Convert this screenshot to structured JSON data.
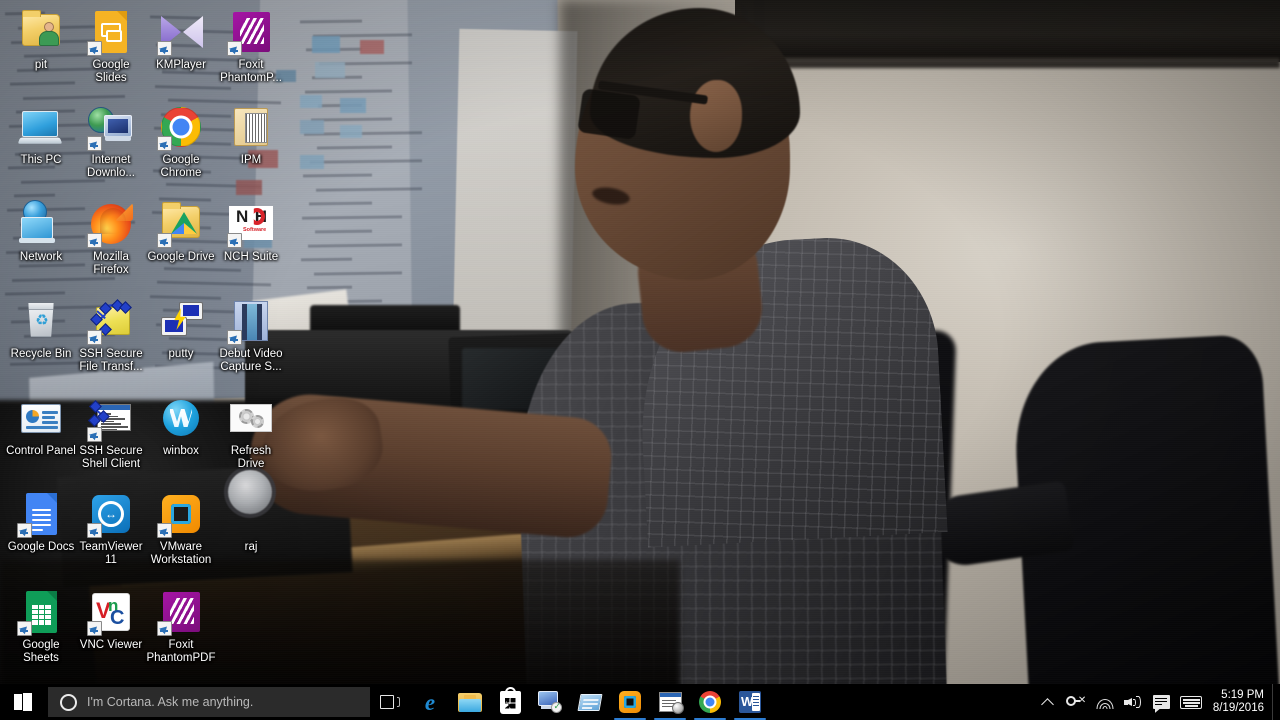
{
  "desktop": {
    "wallpaper_description": "Photo of a man in a checkered shirt wearing glasses, seated at a wooden desk using a keyboard next to a black printer, with an office chair at right",
    "icons": [
      {
        "label": "pit",
        "icon": "user-folder-icon",
        "shortcut": false,
        "col": 0,
        "row": 0
      },
      {
        "label": "Google Slides",
        "icon": "google-slides-icon",
        "shortcut": true,
        "col": 1,
        "row": 0
      },
      {
        "label": "KMPlayer",
        "icon": "kmplayer-icon",
        "shortcut": true,
        "col": 2,
        "row": 0
      },
      {
        "label": "Foxit PhantomP...",
        "icon": "foxit-phantompdf-icon",
        "shortcut": true,
        "col": 3,
        "row": 0
      },
      {
        "label": "This PC",
        "icon": "this-pc-icon",
        "shortcut": false,
        "col": 0,
        "row": 1
      },
      {
        "label": "Internet Downlo...",
        "icon": "internet-download-manager-icon",
        "shortcut": true,
        "col": 1,
        "row": 1
      },
      {
        "label": "Google Chrome",
        "icon": "google-chrome-icon",
        "shortcut": true,
        "col": 2,
        "row": 1
      },
      {
        "label": "IPM",
        "icon": "ipm-folder-icon",
        "shortcut": false,
        "col": 3,
        "row": 1
      },
      {
        "label": "Network",
        "icon": "network-icon",
        "shortcut": false,
        "col": 0,
        "row": 2
      },
      {
        "label": "Mozilla Firefox",
        "icon": "mozilla-firefox-icon",
        "shortcut": true,
        "col": 1,
        "row": 2
      },
      {
        "label": "Google Drive",
        "icon": "google-drive-icon",
        "shortcut": true,
        "col": 2,
        "row": 2
      },
      {
        "label": "NCH Suite",
        "icon": "nch-software-icon",
        "shortcut": true,
        "col": 3,
        "row": 2
      },
      {
        "label": "Recycle Bin",
        "icon": "recycle-bin-icon",
        "shortcut": false,
        "col": 0,
        "row": 3
      },
      {
        "label": "SSH Secure File Transf...",
        "icon": "ssh-secure-file-transfer-icon",
        "shortcut": true,
        "col": 1,
        "row": 3
      },
      {
        "label": "putty",
        "icon": "putty-icon",
        "shortcut": false,
        "col": 2,
        "row": 3
      },
      {
        "label": "Debut Video Capture S...",
        "icon": "debut-video-capture-icon",
        "shortcut": true,
        "col": 3,
        "row": 3
      },
      {
        "label": "Control Panel",
        "icon": "control-panel-icon",
        "shortcut": false,
        "col": 0,
        "row": 4
      },
      {
        "label": "SSH Secure Shell Client",
        "icon": "ssh-secure-shell-client-icon",
        "shortcut": true,
        "col": 1,
        "row": 4
      },
      {
        "label": "winbox",
        "icon": "winbox-icon",
        "shortcut": false,
        "col": 2,
        "row": 4
      },
      {
        "label": "Refresh Drive",
        "icon": "refresh-drive-icon",
        "shortcut": false,
        "col": 3,
        "row": 4
      },
      {
        "label": "Google Docs",
        "icon": "google-docs-icon",
        "shortcut": true,
        "col": 0,
        "row": 5
      },
      {
        "label": "TeamViewer 11",
        "icon": "teamviewer-icon",
        "shortcut": true,
        "col": 1,
        "row": 5
      },
      {
        "label": "VMware Workstation",
        "icon": "vmware-workstation-icon",
        "shortcut": true,
        "col": 2,
        "row": 5
      },
      {
        "label": "raj",
        "icon": "raj-file-icon",
        "shortcut": false,
        "col": 3,
        "row": 5
      },
      {
        "label": "Google Sheets",
        "icon": "google-sheets-icon",
        "shortcut": true,
        "col": 0,
        "row": 6
      },
      {
        "label": "VNC Viewer",
        "icon": "vnc-viewer-icon",
        "shortcut": true,
        "col": 1,
        "row": 6
      },
      {
        "label": "Foxit PhantomPDF",
        "icon": "foxit-phantompdf-icon",
        "shortcut": true,
        "col": 2,
        "row": 6
      }
    ]
  },
  "taskbar": {
    "start": {
      "label": "Start",
      "icon": "windows-logo-icon"
    },
    "search": {
      "placeholder": "I'm Cortana. Ask me anything.",
      "value": "",
      "icon": "cortana-circle-icon"
    },
    "task_view": {
      "label": "Task View",
      "icon": "task-view-icon"
    },
    "pinned": [
      {
        "label": "Microsoft Edge",
        "icon": "microsoft-edge-icon",
        "running": false
      },
      {
        "label": "File Explorer",
        "icon": "file-explorer-icon",
        "running": false
      },
      {
        "label": "Microsoft Store",
        "icon": "microsoft-store-icon",
        "running": false
      },
      {
        "label": "Remote Desktop",
        "icon": "remote-desktop-icon",
        "running": false
      },
      {
        "label": "Notepad",
        "icon": "notepad-icon",
        "running": false
      },
      {
        "label": "VMware Workstation",
        "icon": "vmware-icon",
        "running": true
      },
      {
        "label": "SSH Secure Shell Client",
        "icon": "ssh-shell-client-icon",
        "running": true
      },
      {
        "label": "Google Chrome",
        "icon": "chrome-icon",
        "running": true
      },
      {
        "label": "Microsoft Word",
        "icon": "microsoft-word-icon",
        "running": true
      }
    ],
    "tray": [
      {
        "label": "Show hidden icons",
        "icon": "chevron-up-icon"
      },
      {
        "label": "Network sign-in required",
        "icon": "network-key-warning-icon"
      },
      {
        "label": "Wireless network",
        "icon": "wifi-icon"
      },
      {
        "label": "Speakers",
        "icon": "volume-icon"
      },
      {
        "label": "Action Center",
        "icon": "action-center-icon"
      },
      {
        "label": "Touch keyboard",
        "icon": "touch-keyboard-icon"
      }
    ],
    "clock": {
      "time": "5:19 PM",
      "date": "8/19/2016"
    },
    "colors": {
      "taskbar_bg": "#000000",
      "search_bg": "#2b2b2b",
      "running_underline": "#2d7dd2",
      "text": "#ffffff",
      "placeholder_text": "#b9b9b9"
    }
  }
}
